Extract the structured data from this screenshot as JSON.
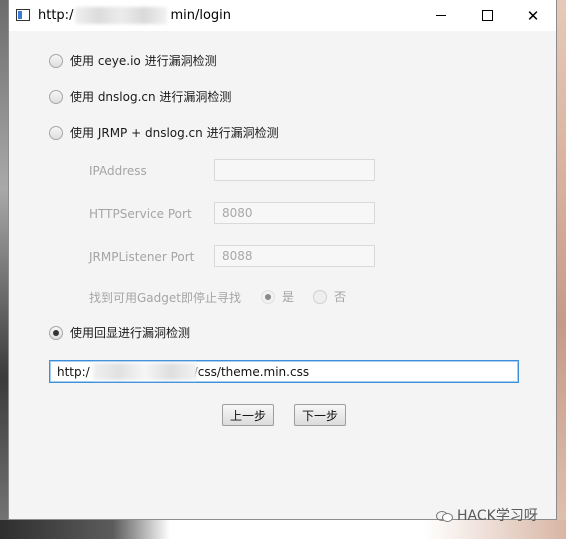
{
  "window": {
    "title_prefix": "http:/",
    "title_suffix": "min/login",
    "minimize_label": "minimize",
    "maximize_label": "maximize",
    "close_label": "✕"
  },
  "options": {
    "ceye": "使用 ceye.io 进行漏洞检测",
    "dnslog": "使用 dnslog.cn 进行漏洞检测",
    "jrmp": "使用 JRMP + dnslog.cn 进行漏洞检测",
    "echo": "使用回显进行漏洞检测"
  },
  "fields": {
    "ip_label": "IPAddress",
    "ip_value": "",
    "http_label": "HTTPService Port",
    "http_value": "8080",
    "jrmp_label": "JRMPListener Port",
    "jrmp_value": "8088",
    "gadget_label": "找到可用Gadget即停止寻找",
    "yes_label": "是",
    "no_label": "否"
  },
  "url": {
    "prefix": "http:/",
    "suffix": ":/css/theme.min.css"
  },
  "buttons": {
    "prev": "上一步",
    "next": "下一步"
  },
  "watermark": {
    "text": "HACK学习呀"
  }
}
